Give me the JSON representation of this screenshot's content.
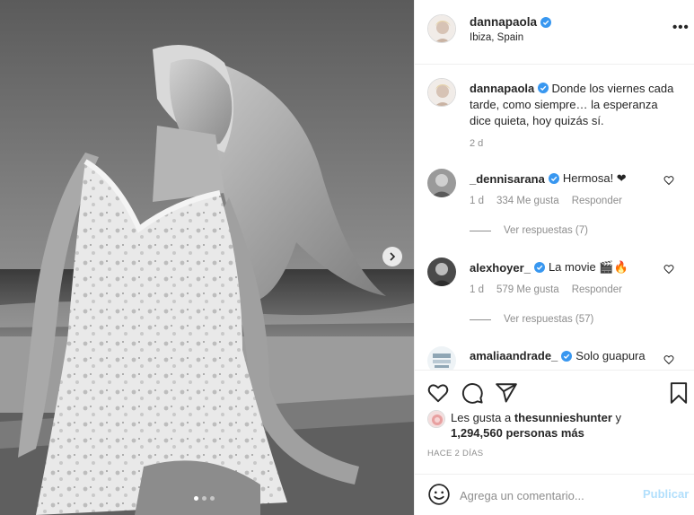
{
  "post": {
    "username": "dannapaola",
    "location": "Ibiza, Spain",
    "more_label": "•••",
    "caption": "Donde los viernes cada tarde, como siempre… la esperanza dice quieta, hoy quizás sí.",
    "caption_time": "2 d"
  },
  "comments": [
    {
      "username": "_dennisarana",
      "text": "Hermosa! ❤",
      "time": "1 d",
      "likes": "334 Me gusta",
      "reply_label": "Responder",
      "replies_label": "Ver respuestas (7)"
    },
    {
      "username": "alexhoyer_",
      "text": "La movie 🎬🔥",
      "time": "1 d",
      "likes": "579 Me gusta",
      "reply_label": "Responder",
      "replies_label": "Ver respuestas (57)"
    },
    {
      "username": "amaliaandrade_",
      "text": "Solo guapura"
    }
  ],
  "likes": {
    "prefix": "Les gusta a",
    "user": "thesunnieshunter",
    "joiner": "y",
    "count": "1,294,560 personas más"
  },
  "time_ago": "HACE 2 DÍAS",
  "add_comment": {
    "placeholder": "Agrega un comentario...",
    "publish_label": "Publicar"
  },
  "carousel": {
    "slides": 3,
    "active_index": 0
  },
  "colors": {
    "verified": "#3897f0",
    "publish_disabled": "#b2dffc",
    "muted": "#8e8e8e"
  },
  "icons": [
    "heart-icon",
    "comment-icon",
    "share-icon",
    "bookmark-icon",
    "emoji-icon",
    "verified-badge-icon",
    "chevron-right-icon",
    "more-options-icon"
  ]
}
